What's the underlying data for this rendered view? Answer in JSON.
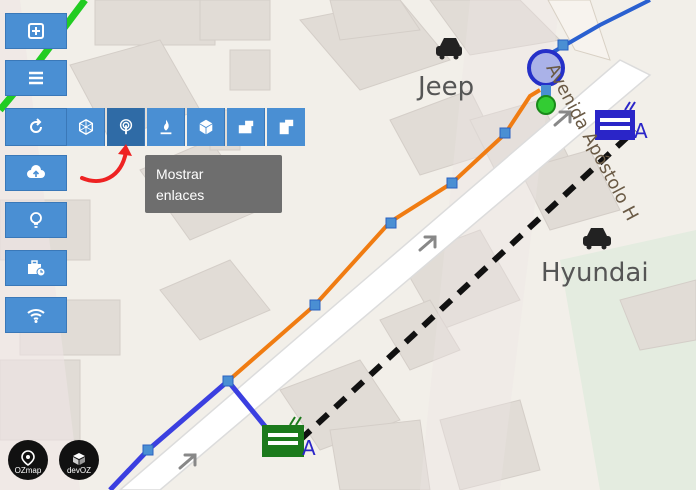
{
  "map": {
    "street_name": "Avenida Apóstolo H",
    "places": [
      {
        "name": "Jeep",
        "icon": "car-icon"
      },
      {
        "name": "Hyundai",
        "icon": "car-icon"
      }
    ]
  },
  "toolbar": {
    "buttons": [
      {
        "name": "zoom-in-button",
        "icon": "plus-icon"
      },
      {
        "name": "menu-button",
        "icon": "hamburger-icon"
      },
      {
        "name": "refresh-button",
        "icon": "refresh-icon"
      },
      {
        "name": "upload-button",
        "icon": "cloud-upload-icon"
      },
      {
        "name": "lightbulb-button",
        "icon": "lightbulb-icon"
      },
      {
        "name": "briefcase-clock-button",
        "icon": "briefcase-clock-icon"
      },
      {
        "name": "wifi-button",
        "icon": "wifi-icon"
      }
    ],
    "submenu": [
      {
        "name": "network-button",
        "icon": "network-icon"
      },
      {
        "name": "show-links-button",
        "icon": "signal-icon",
        "active": true
      },
      {
        "name": "flame-button",
        "icon": "flame-icon"
      },
      {
        "name": "box-button",
        "icon": "box-icon"
      },
      {
        "name": "message-button",
        "icon": "message-icon"
      },
      {
        "name": "document-button",
        "icon": "document-icon"
      }
    ]
  },
  "tooltip": {
    "text": "Mostrar\nenlaces"
  },
  "logos": {
    "ozmap": "OZmap",
    "devoz": "devOZ"
  },
  "colors": {
    "button": "#4a8fd3",
    "orange_route": "#f07c12",
    "blue_route": "#3b3fe0",
    "green_route": "#22cc22",
    "dashed_link": "#111111"
  }
}
